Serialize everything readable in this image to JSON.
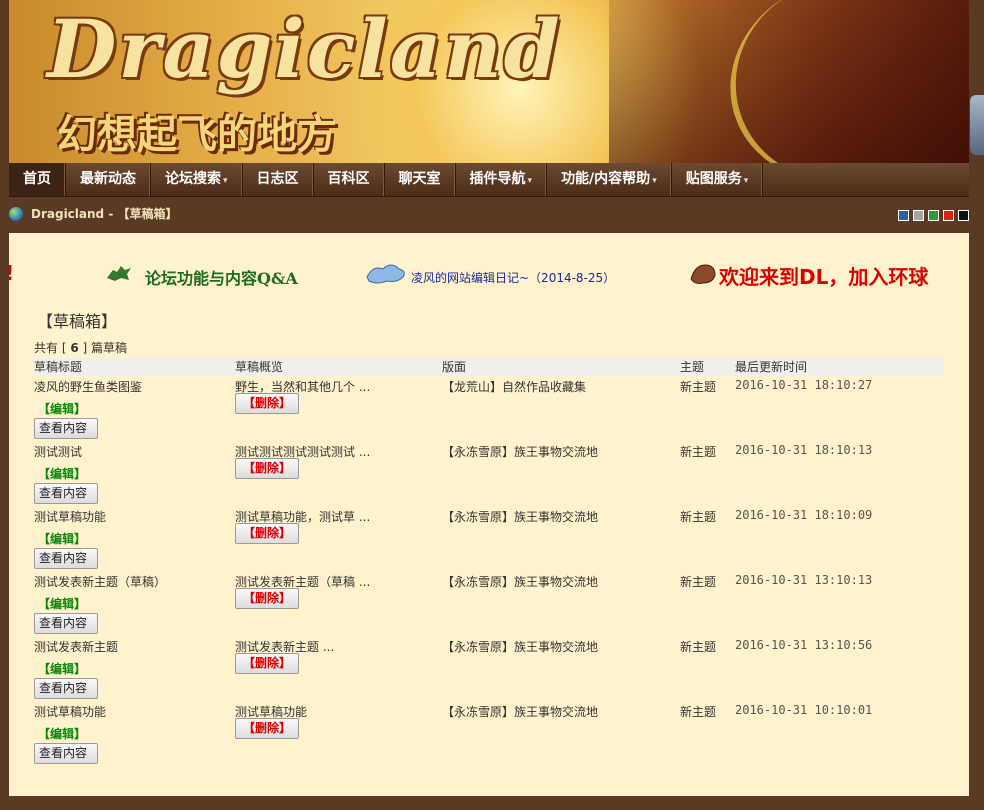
{
  "site": {
    "logo_text": "Dragicland",
    "slogan": "幻想起飞的地方"
  },
  "nav": {
    "items": [
      {
        "label": "首页",
        "dropdown": false,
        "active": true
      },
      {
        "label": "最新动态",
        "dropdown": false
      },
      {
        "label": "论坛搜索",
        "dropdown": true
      },
      {
        "label": "日志区",
        "dropdown": false
      },
      {
        "label": "百科区",
        "dropdown": false
      },
      {
        "label": "聊天室",
        "dropdown": false
      },
      {
        "label": "插件导航",
        "dropdown": true
      },
      {
        "label": "功能/内容帮助",
        "dropdown": true
      },
      {
        "label": "贴图服务",
        "dropdown": true
      }
    ],
    "caret": "▾"
  },
  "breadcrumb": {
    "text": "Dragicland - 【草稿箱】"
  },
  "style_swatches": [
    "#2f5fa3",
    "#a5a5a5",
    "#2f9a3a",
    "#e01d1d",
    "#111111"
  ],
  "ticker": {
    "fragment": "!",
    "item1": "论坛功能与内容Q&A",
    "item2": "凌风的网站编辑日记~（2014-8-25）",
    "item3_prefix": "欢迎来到",
    "item3_bold": "DL",
    "item3_suffix": "，加入环球"
  },
  "page_title": "【草稿箱】",
  "summary": {
    "prefix": "共有 [ ",
    "count": "6",
    "suffix": " ] 篇草稿"
  },
  "table": {
    "headers": {
      "title": "草稿标题",
      "preview": "草稿概览",
      "board": "版面",
      "topic": "主题",
      "updated": "最后更新时间"
    },
    "edit_label": "【编辑】",
    "view_label": "查看内容",
    "delete_label": "【删除】",
    "rows": [
      {
        "title": "凌风的野生鱼类图鉴",
        "preview": "野生，当然和其他几个 ...",
        "board": "【龙荒山】自然作品收藏集",
        "topic": "新主题",
        "updated": "2016-10-31 18:10:27"
      },
      {
        "title": "测试测试",
        "preview": "测试测试测试测试测试 ...",
        "board": "【永冻雪原】族王事物交流地",
        "topic": "新主题",
        "updated": "2016-10-31 18:10:13"
      },
      {
        "title": "测试草稿功能",
        "preview": "测试草稿功能，测试草 ...",
        "board": "【永冻雪原】族王事物交流地",
        "topic": "新主题",
        "updated": "2016-10-31 18:10:09"
      },
      {
        "title": "测试发表新主题（草稿）",
        "preview": "测试发表新主题（草稿 ...",
        "board": "【永冻雪原】族王事物交流地",
        "topic": "新主题",
        "updated": "2016-10-31 13:10:13"
      },
      {
        "title": "测试发表新主题",
        "preview": "测试发表新主题 ...",
        "board": "【永冻雪原】族王事物交流地",
        "topic": "新主题",
        "updated": "2016-10-31 13:10:56"
      },
      {
        "title": "测试草稿功能",
        "preview": "测试草稿功能",
        "board": "【永冻雪原】族王事物交流地",
        "topic": "新主题",
        "updated": "2016-10-31 10:10:01"
      }
    ]
  }
}
